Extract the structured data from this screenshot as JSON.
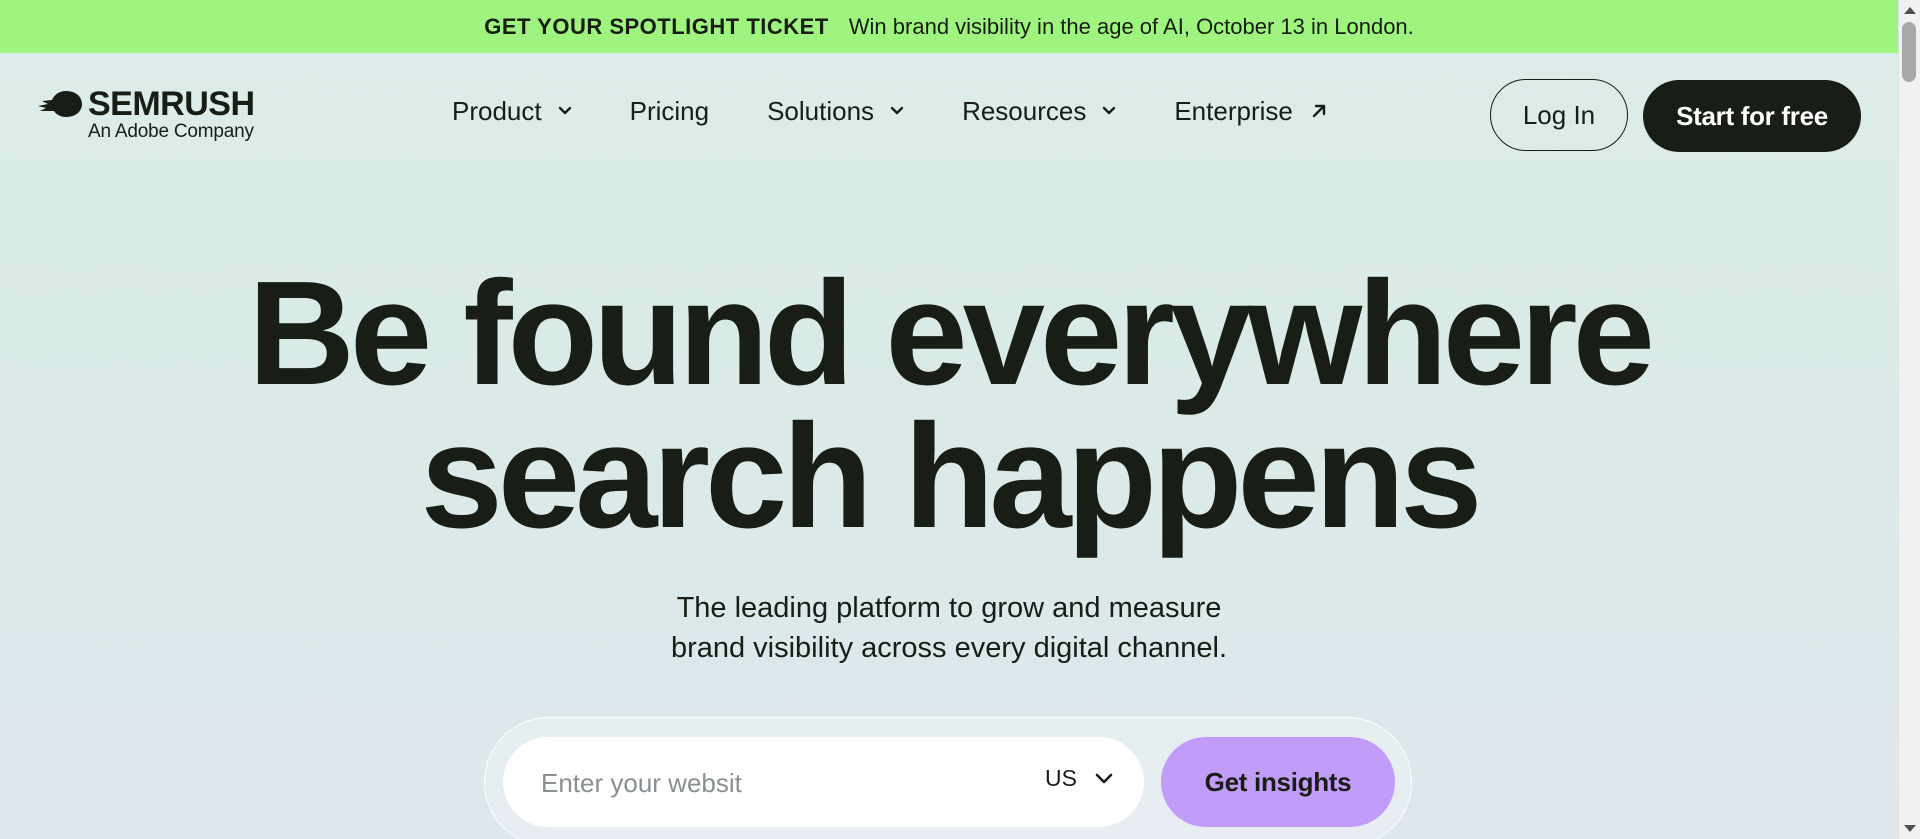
{
  "banner": {
    "strong": "GET YOUR SPOTLIGHT TICKET",
    "text": "Win brand visibility in the age of AI, October 13 in London."
  },
  "logo": {
    "name": "SEMRUSH",
    "sub": "An Adobe Company"
  },
  "nav": {
    "items": [
      {
        "label": "Product",
        "icon": "chevron-down-icon"
      },
      {
        "label": "Pricing"
      },
      {
        "label": "Solutions",
        "icon": "chevron-down-icon"
      },
      {
        "label": "Resources",
        "icon": "chevron-down-icon"
      },
      {
        "label": "Enterprise",
        "icon": "external-arrow-icon"
      }
    ]
  },
  "header": {
    "login_label": "Log In",
    "start_label": "Start for free"
  },
  "hero": {
    "title_line1": "Be found everywhere",
    "title_line2": "search happens",
    "sub_line1": "The leading platform to grow and measure",
    "sub_line2": "brand visibility across every digital channel."
  },
  "search": {
    "placeholder": "Enter your websit",
    "value": "",
    "country": "US",
    "button_label": "Get insights"
  },
  "colors": {
    "banner_bg": "#9ff47f",
    "dark": "#181e15",
    "accent_purple": "#c29cf9"
  }
}
